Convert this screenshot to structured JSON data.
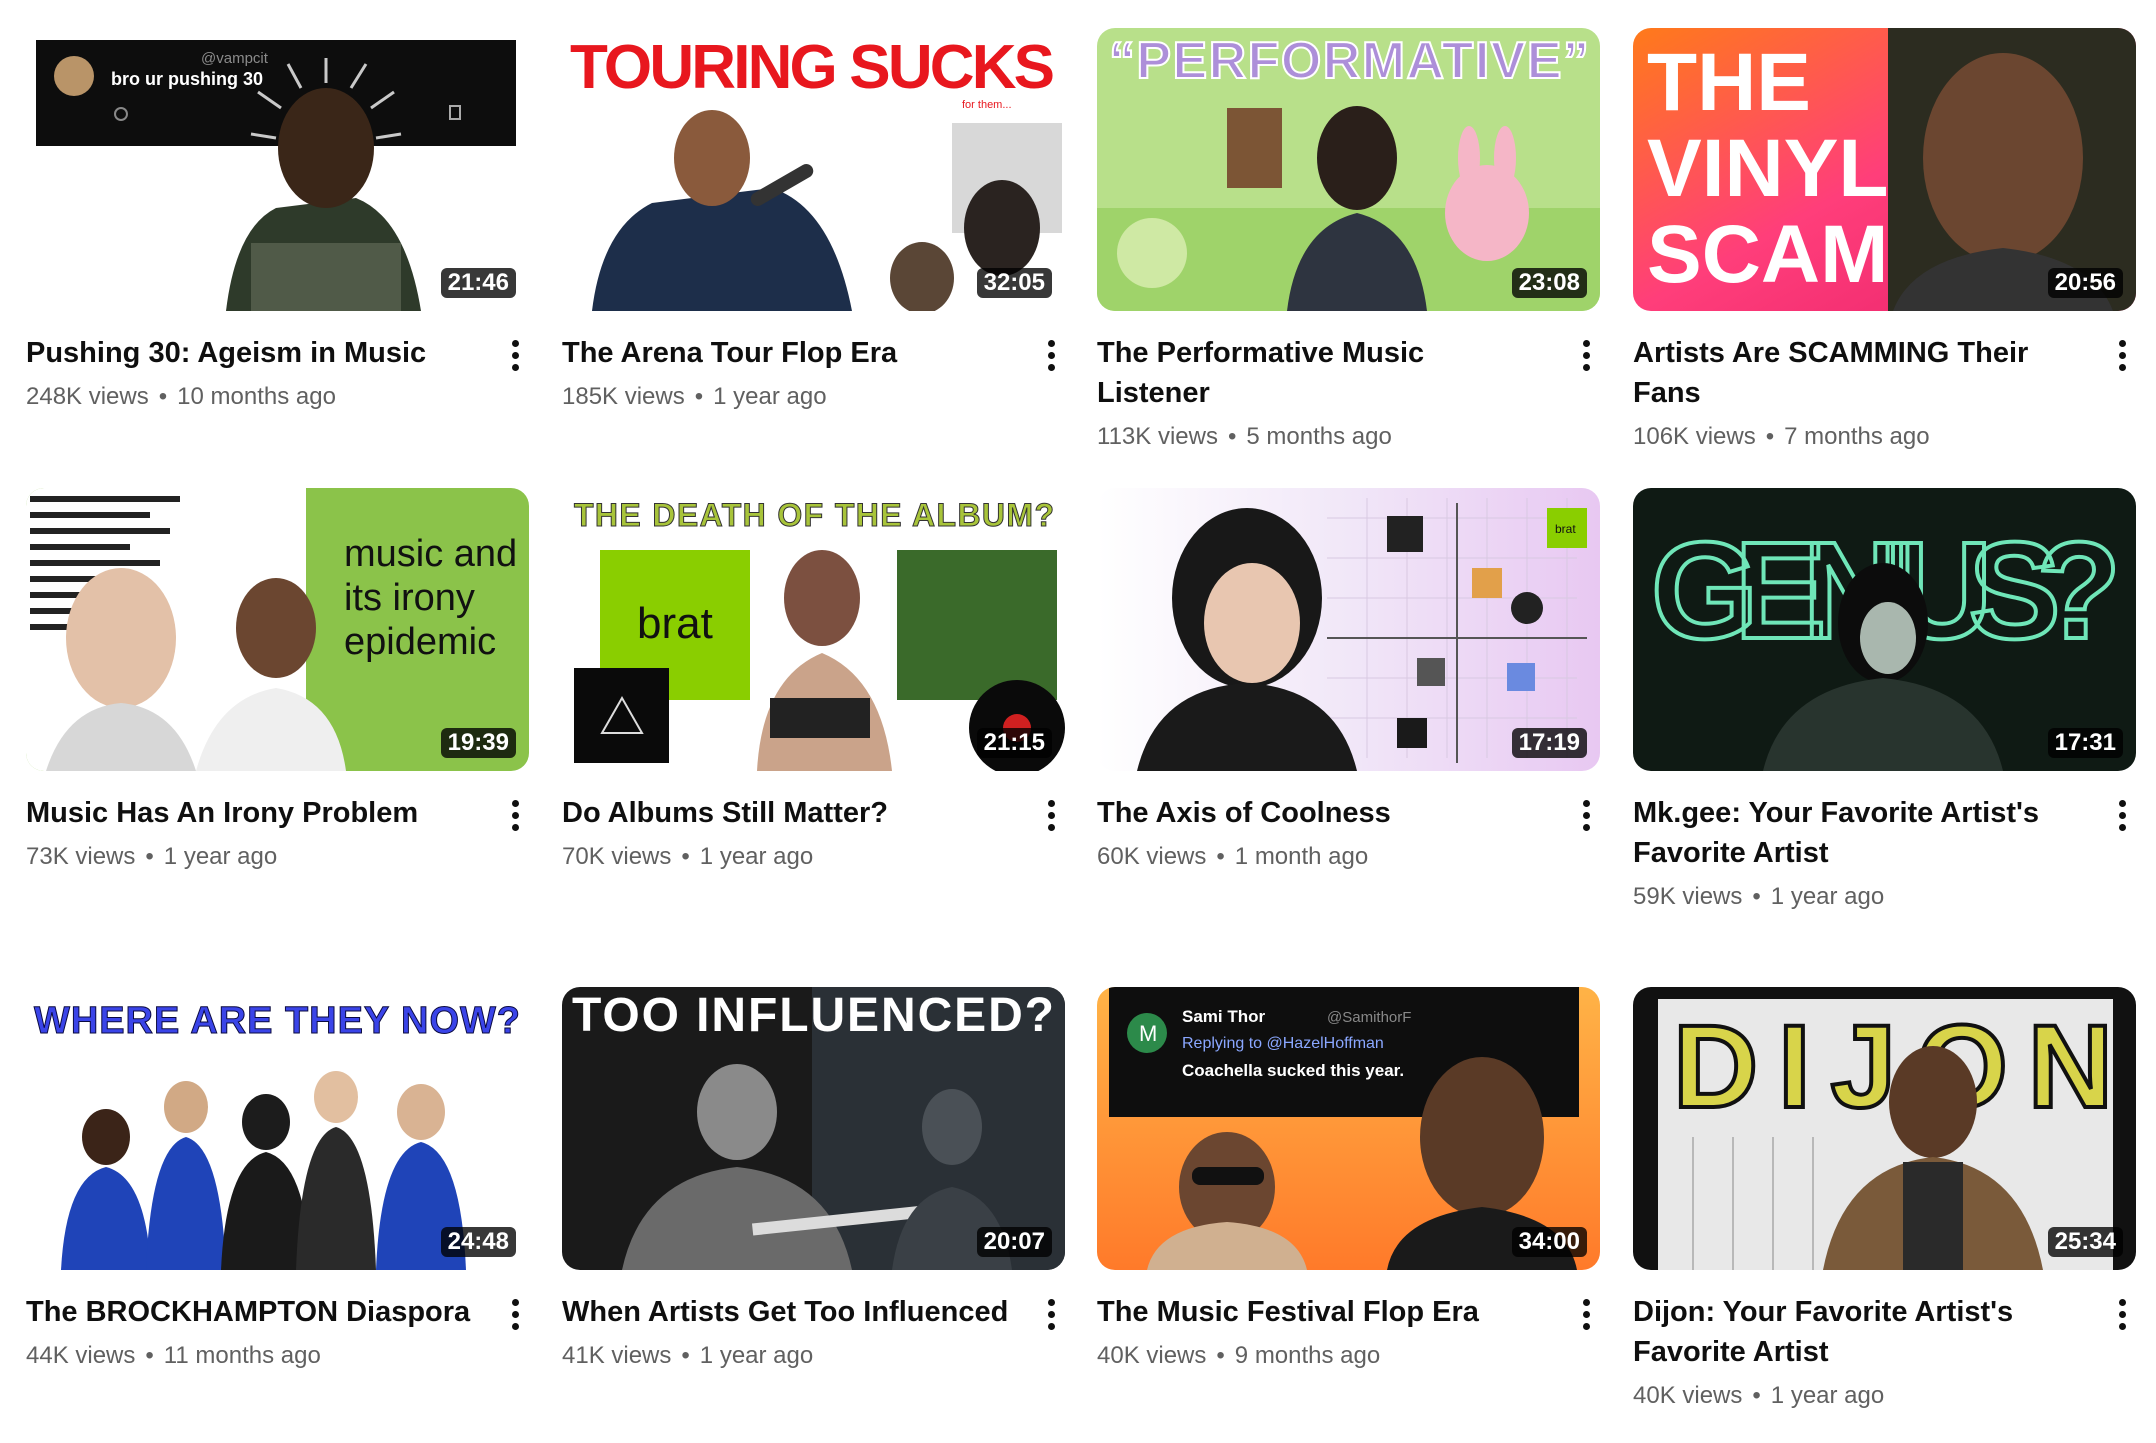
{
  "videos": [
    {
      "title": "Pushing 30: Ageism in Music",
      "views": "248K views",
      "age": "10 months ago",
      "duration": "21:46",
      "thumb_text": {
        "handle": "@vampcit",
        "tweet": "bro ur pushing 30"
      }
    },
    {
      "title": "The Arena Tour Flop Era",
      "views": "185K views",
      "age": "1 year ago",
      "duration": "32:05",
      "thumb_text": {
        "headline": "TOURING SUCKS",
        "sub": "for them..."
      }
    },
    {
      "title": "The Performative Music Listener",
      "views": "113K views",
      "age": "5 months ago",
      "duration": "23:08",
      "thumb_text": {
        "headline": "“PERFORMATIVE”"
      }
    },
    {
      "title": "Artists Are SCAMMING Their Fans",
      "views": "106K views",
      "age": "7 months ago",
      "duration": "20:56",
      "thumb_text": {
        "line1": "THE",
        "line2": "VINYL",
        "line3": "SCAM"
      }
    },
    {
      "title": "Music Has An Irony Problem",
      "views": "73K views",
      "age": "1 year ago",
      "duration": "19:39",
      "thumb_text": {
        "line1": "music and",
        "line2": "its irony",
        "line3": "epidemic"
      }
    },
    {
      "title": "Do Albums Still Matter?",
      "views": "70K views",
      "age": "1 year ago",
      "duration": "21:15",
      "thumb_text": {
        "headline": "THE DEATH OF THE ALBUM?",
        "album": "brat"
      }
    },
    {
      "title": "The Axis of Coolness",
      "views": "60K views",
      "age": "1 month ago",
      "duration": "17:19",
      "thumb_text": {
        "tag": "brat"
      }
    },
    {
      "title": "Mk.gee: Your Favorite Artist's Favorite Artist",
      "views": "59K views",
      "age": "1 year ago",
      "duration": "17:31",
      "thumb_text": {
        "headline": "GENIUS?"
      }
    },
    {
      "title": "The BROCKHAMPTON Diaspora",
      "views": "44K views",
      "age": "11 months ago",
      "duration": "24:48",
      "thumb_text": {
        "headline": "WHERE ARE THEY NOW?"
      }
    },
    {
      "title": "When Artists Get Too Influenced",
      "views": "41K views",
      "age": "1 year ago",
      "duration": "20:07",
      "thumb_text": {
        "headline": "TOO INFLUENCED?"
      }
    },
    {
      "title": "The Music Festival Flop Era",
      "views": "40K views",
      "age": "9 months ago",
      "duration": "34:00",
      "thumb_text": {
        "avatar": "M",
        "name": "Sami Thor",
        "handle": "@SamithorF",
        "reply": "Replying to @HazelHoffman",
        "tweet": "Coachella sucked this year."
      }
    },
    {
      "title": "Dijon: Your Favorite Artist's Favorite Artist",
      "views": "40K views",
      "age": "1 year ago",
      "duration": "25:34",
      "thumb_text": {
        "headline": "DIJON"
      }
    }
  ],
  "separator": "•",
  "colors": {
    "title": "#0f0f0f",
    "meta": "#606060",
    "duration_bg": "#000000",
    "brat_green": "#8ace00"
  }
}
